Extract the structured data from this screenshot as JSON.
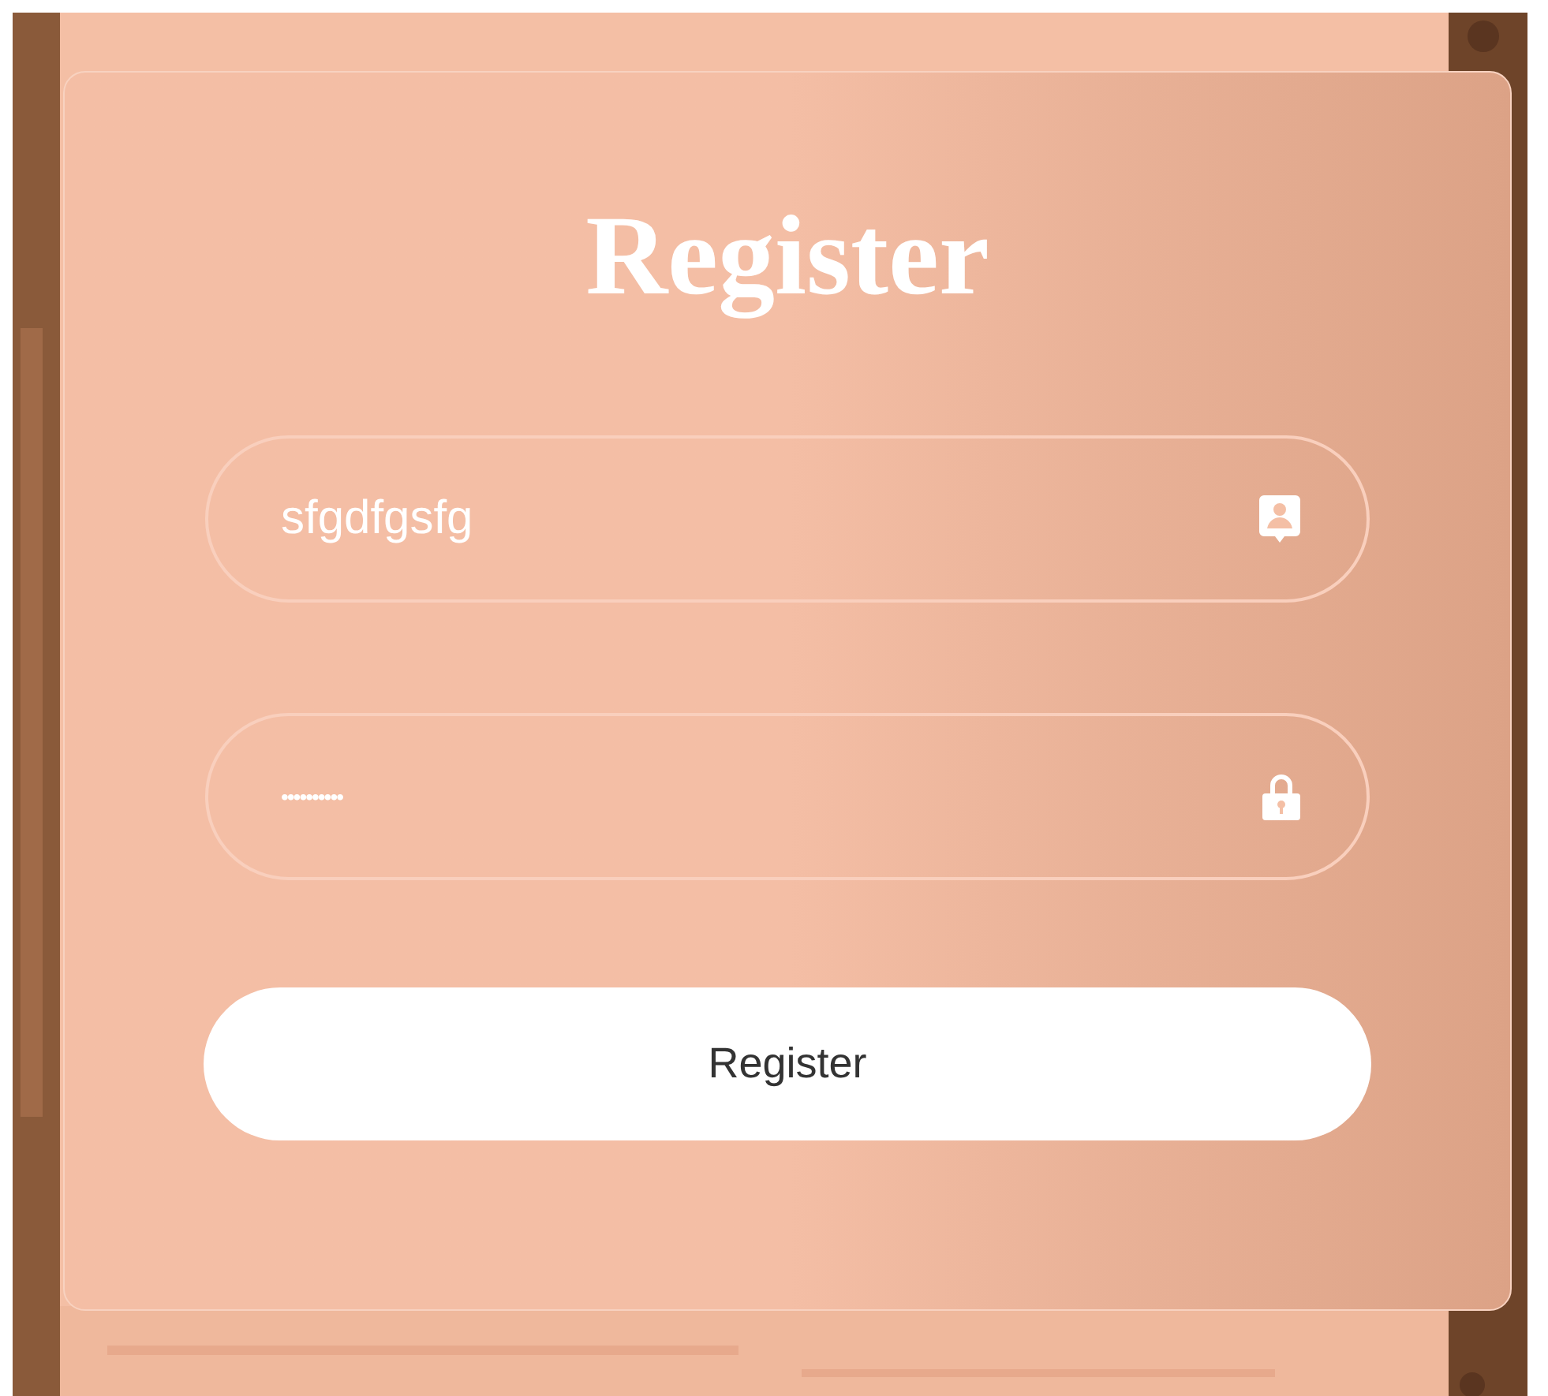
{
  "form": {
    "title": "Register",
    "fields": [
      {
        "kind": "username",
        "value": "sfgdfgsfg"
      },
      {
        "kind": "password",
        "value": "••••••••••"
      }
    ],
    "submit_button": "Register"
  }
}
